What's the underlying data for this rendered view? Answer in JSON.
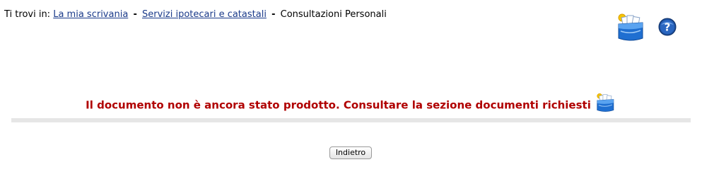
{
  "breadcrumb": {
    "prefix": "Ti trovi in:",
    "items": [
      {
        "label": "La mia scrivania",
        "link": true
      },
      {
        "label": "Servizi ipotecari e catastali",
        "link": true
      },
      {
        "label": "Consultazioni Personali",
        "link": false
      }
    ],
    "separator": "-"
  },
  "toolbar": {
    "requested_docs_icon": "document-box-icon",
    "help_icon": "help-icon"
  },
  "message": {
    "text": "Il documento non è ancora stato prodotto. Consultare la sezione documenti richiesti",
    "icon": "document-box-icon",
    "color": "#b00000"
  },
  "actions": {
    "back_label": "Indietro"
  },
  "colors": {
    "link": "#1a3a8a",
    "divider": "#e6e6e6"
  }
}
